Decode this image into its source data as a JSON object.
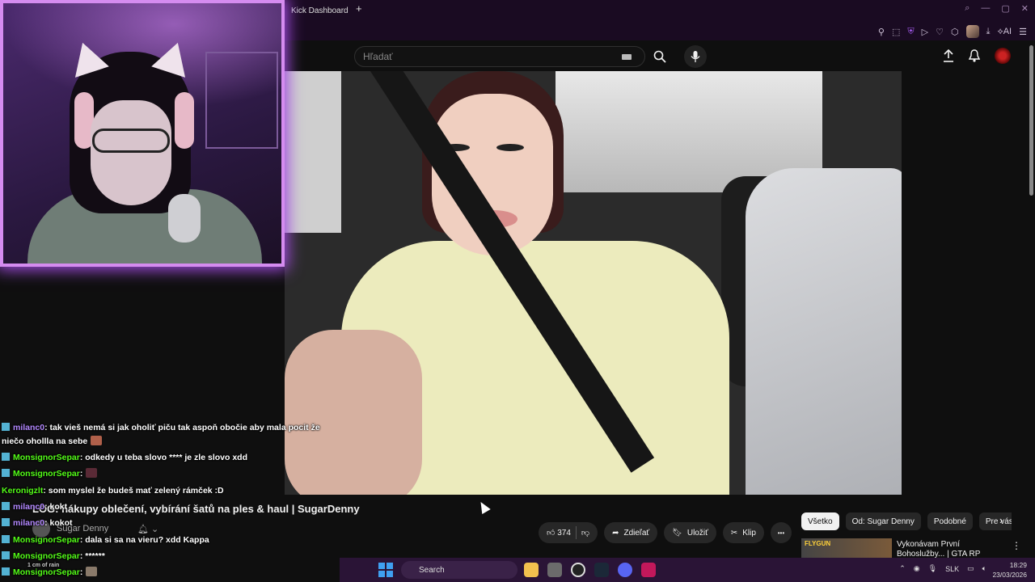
{
  "browser": {
    "tab_title": "Kick Dashboard",
    "new_tab_symbol": "+",
    "toolbar_ai_label": "AI"
  },
  "youtube": {
    "search_placeholder": "Hľadať",
    "video_title": "LOG: nákupy oblečení, vybírání šatů na ples & haul | SugarDenny",
    "channel_name": "Sugar Denny",
    "like_count": "374",
    "share_label": "Zdieľať",
    "save_label": "Uložiť",
    "clip_label": "Klip",
    "more_label": "•••",
    "chips": [
      "Všetko",
      "Od: Sugar Denny",
      "Podobné",
      "Pre vás"
    ],
    "recommendation": {
      "thumb_text": "FLYGUN",
      "title": "Vykonávam První Bohoslužby... | GTA RP"
    }
  },
  "chat": {
    "messages": [
      {
        "user": "milanc0",
        "text": ": tak vieš nemá si jak oholiť piču tak aspoň obočie aby mala pocit že"
      },
      {
        "user": "",
        "text": "niečo ohollla na sebe"
      },
      {
        "user": "MonsignorSepar",
        "text": ": odkedy u teba slovo **** je zle slovo xdd"
      },
      {
        "user": "MonsignorSepar",
        "text": ":"
      },
      {
        "user": "Keronigzlt",
        "text": ": som myslel že budeš mať zelený rámček :D"
      },
      {
        "user": "milanc0",
        "text": ": kokt"
      },
      {
        "user": "milanc0",
        "text": ": kokot"
      },
      {
        "user": "MonsignorSepar",
        "text": ": dala si sa na vieru? xdd Kappa"
      },
      {
        "user": "MonsignorSepar",
        "text": ": ******"
      },
      {
        "user": "MonsignorSepar",
        "text": ":"
      }
    ]
  },
  "taskbar": {
    "search_label": "Search",
    "language": "SLK",
    "time": "18:29",
    "date": "23/03/2026",
    "weather": "1 cm of rain"
  }
}
